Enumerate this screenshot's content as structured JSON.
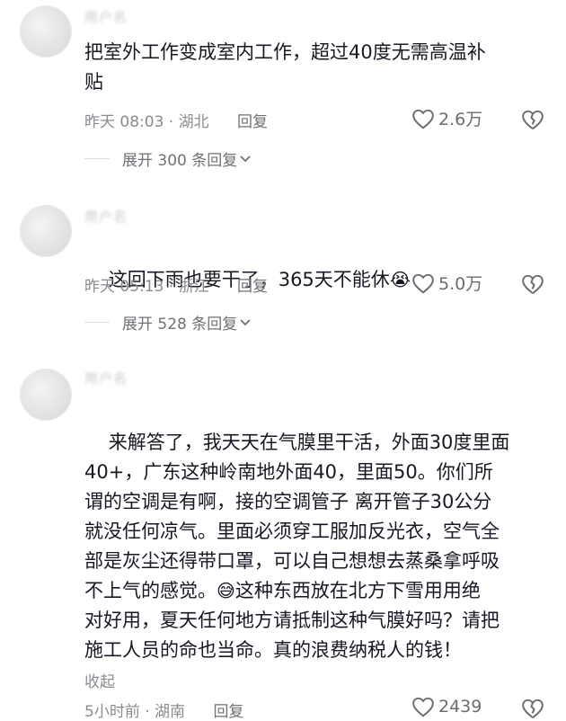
{
  "comments": [
    {
      "text": "把室外工作变成室内工作，超过40度无需高温补\n贴",
      "time_location": "昨天 08:03 · 湖北",
      "reply_label": "回复",
      "likes": "2.6万",
      "expand_label": "展开 300 条回复"
    },
    {
      "text": "这回下雨也要干了，365天不能休",
      "emoji": "😭",
      "time_location": "昨天 05:13 · 浙江",
      "reply_label": "回复",
      "likes": "5.0万",
      "expand_label": "展开 528 条回复"
    },
    {
      "text_part1": "来解答了，我天天在气膜里干活，外面30度里面\n40+，广东这种岭南地外面40，里面50。你们所\n谓的空调是有啊，接的空调管子 离开管子30公分\n就没任何凉气。里面必须穿工服加反光衣，空气全\n部是灰尘还得带口罩，可以自己想想去蒸桑拿呼吸\n不上气的感觉。",
      "emoji": "😅",
      "text_part2": "这种东西放在北方下雪用用绝\n对好用，夏天任何地方请抵制这种气膜好吗？请把\n施工人员的命也当命。真的浪费纳税人的钱！",
      "collapse_label": "收起",
      "time_location": "5小时前 · 湖南",
      "reply_label": "回复",
      "likes": "2439"
    }
  ]
}
